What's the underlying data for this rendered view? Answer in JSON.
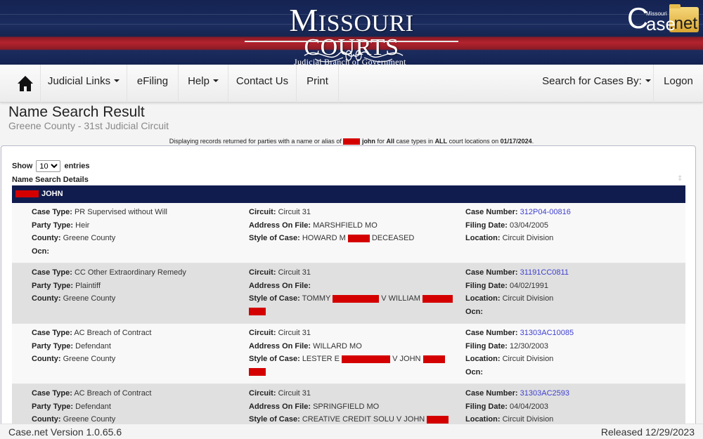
{
  "header": {
    "logo_title_first": "M",
    "logo_title_rest": "ISSOURI COURTS",
    "logo_subtitle": "Judicial Branch of Government",
    "casenet_logo": {
      "c": "C",
      "ase": "ase",
      "net": ".net",
      "state": "Missouri"
    }
  },
  "nav": {
    "home_icon": "home-icon",
    "items": [
      {
        "label": "Judicial Links",
        "dropdown": true
      },
      {
        "label": "eFiling",
        "dropdown": false
      },
      {
        "label": "Help",
        "dropdown": true
      },
      {
        "label": "Contact Us",
        "dropdown": false
      },
      {
        "label": "Print",
        "dropdown": false
      }
    ],
    "search_cases": {
      "label": "Search for Cases By:",
      "dropdown": true
    },
    "logon": {
      "label": "Logon"
    }
  },
  "page": {
    "title": "Name Search Result",
    "subtitle": "Greene County - 31st Judicial Circuit",
    "display_msg": {
      "prefix": "Displaying records returned for parties with a name or alias of",
      "name": "john",
      "mid1": "for",
      "case_types": "All",
      "mid2": "case types in",
      "locations": "ALL",
      "mid3": "court locations on",
      "date": "01/17/2024",
      "end": "."
    }
  },
  "table": {
    "show_label": "Show",
    "entries_label": "entries",
    "page_size": "10",
    "page_size_options": [
      "10"
    ],
    "details_label": "Name Search Details",
    "party_name": "JOHN",
    "labels": {
      "case_type": "Case Type:",
      "party_type": "Party Type:",
      "county": "County:",
      "ocn": "Ocn:",
      "circuit": "Circuit:",
      "address": "Address On File:",
      "style": "Style of Case:",
      "case_number": "Case Number:",
      "filing_date": "Filing Date:",
      "location": "Location:"
    },
    "rows": [
      {
        "case_type": "PR Supervised without Will",
        "party_type": "Heir",
        "county": "Greene County",
        "ocn": "",
        "circuit": "Circuit 31",
        "address": "MARSHFIELD MO",
        "style_parts": [
          "HOWARD M",
          "[redacted]",
          "DECEASED"
        ],
        "case_number": "312P04-00816",
        "filing_date": "03/04/2005",
        "location": "Circuit Division"
      },
      {
        "case_type": "CC Other Extraordinary Remedy",
        "party_type": "Plaintiff",
        "county": "Greene County",
        "circuit": "Circuit 31",
        "address": "",
        "style_parts": [
          "TOMMY",
          "[redacted]",
          "V WILLIAM",
          "[redacted]"
        ],
        "case_number": "31191CC0811",
        "filing_date": "04/02/1991",
        "location": "Circuit Division",
        "ocn": ""
      },
      {
        "case_type": "AC Breach of Contract",
        "party_type": "Defendant",
        "county": "Greene County",
        "circuit": "Circuit 31",
        "address": "WILLARD MO",
        "style_parts": [
          "LESTER E",
          "[redacted]",
          "V JOHN",
          "[redacted]"
        ],
        "case_number": "31303AC10085",
        "filing_date": "12/30/2003",
        "location": "Circuit Division",
        "ocn": ""
      },
      {
        "case_type": "AC Breach of Contract",
        "party_type": "Defendant",
        "county": "Greene County",
        "circuit": "Circuit 31",
        "address": "SPRINGFIELD MO",
        "style_parts": [
          "CREATIVE CREDIT SOLU V JOHN",
          "[redacted]"
        ],
        "case_number": "31303AC2593",
        "filing_date": "04/04/2003",
        "location": "Circuit Division"
      }
    ]
  },
  "footer": {
    "version": "Case.net Version 1.0.65.6",
    "released": "Released 12/29/2023"
  },
  "colors": {
    "banner_blue": "#142352",
    "banner_red": "#b3232e",
    "header_navy": "#111c4e",
    "link_blue": "#3d3fcf",
    "redaction": "#d40000"
  }
}
